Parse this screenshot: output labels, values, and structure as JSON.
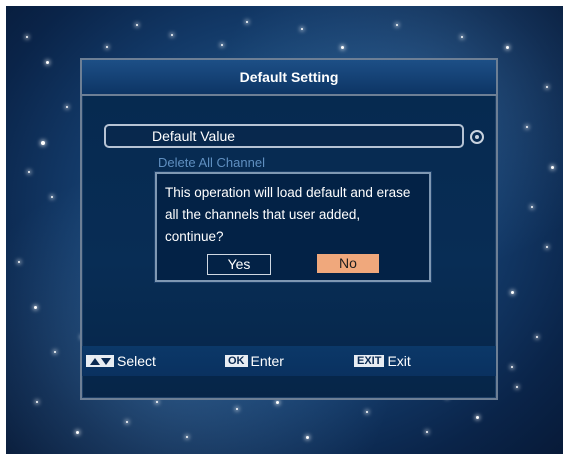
{
  "dialog_title": "Default Setting",
  "menu": {
    "selected_label": "Default Value",
    "second_label": "Delete All Channel"
  },
  "dialog": {
    "message": "This operation will load default and erase all the channels that user added, continue?",
    "yes_label": "Yes",
    "no_label": "No"
  },
  "footer": {
    "select_key": "",
    "select_label": "Select",
    "enter_key": "OK",
    "enter_label": "Enter",
    "exit_key": "EXIT",
    "exit_label": "Exit"
  },
  "colors": {
    "accent_button": "#f0a87c",
    "panel_bg": "#082d55",
    "border": "#6d7f95"
  },
  "icons": {
    "radio": "radio-selected-icon",
    "arrows": "up-down-arrows-icon"
  }
}
